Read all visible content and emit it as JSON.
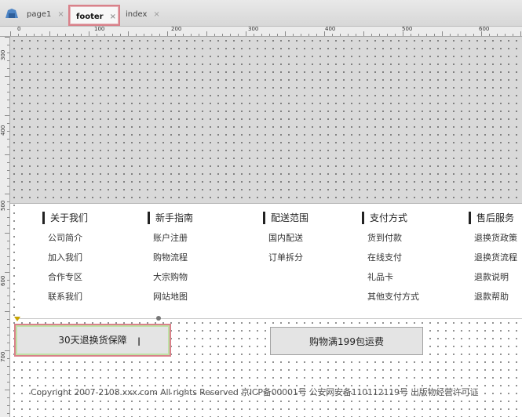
{
  "tabs": [
    {
      "label": "page1",
      "close": "×"
    },
    {
      "label": "footer",
      "close": "×"
    },
    {
      "label": "index",
      "close": "×"
    }
  ],
  "ruler_top": [
    "0",
    "100",
    "200",
    "300",
    "400",
    "500",
    "600"
  ],
  "ruler_left": [
    "300",
    "400",
    "500",
    "600",
    "700"
  ],
  "footer_nav": [
    {
      "title": "关于我们",
      "items": [
        "公司简介",
        "加入我们",
        "合作专区",
        "联系我们"
      ]
    },
    {
      "title": "新手指南",
      "items": [
        "账户注册",
        "购物流程",
        "大宗购物",
        "网站地图"
      ]
    },
    {
      "title": "配送范围",
      "items": [
        "国内配送",
        "订单拆分"
      ]
    },
    {
      "title": "支付方式",
      "items": [
        "货到付款",
        "在线支付",
        "礼品卡",
        "其他支付方式"
      ]
    },
    {
      "title": "售后服务",
      "items": [
        "退换货政策",
        "退换货流程",
        "退款说明",
        "退款帮助"
      ]
    }
  ],
  "buttons": {
    "return": "30天退换货保障",
    "shipping": "购物满199包运费"
  },
  "copyright": "Copyright 2007-2108.xxx.com All rights Reserved 京ICP备00001号  公安网安备110112119号  出版物经营许可证"
}
